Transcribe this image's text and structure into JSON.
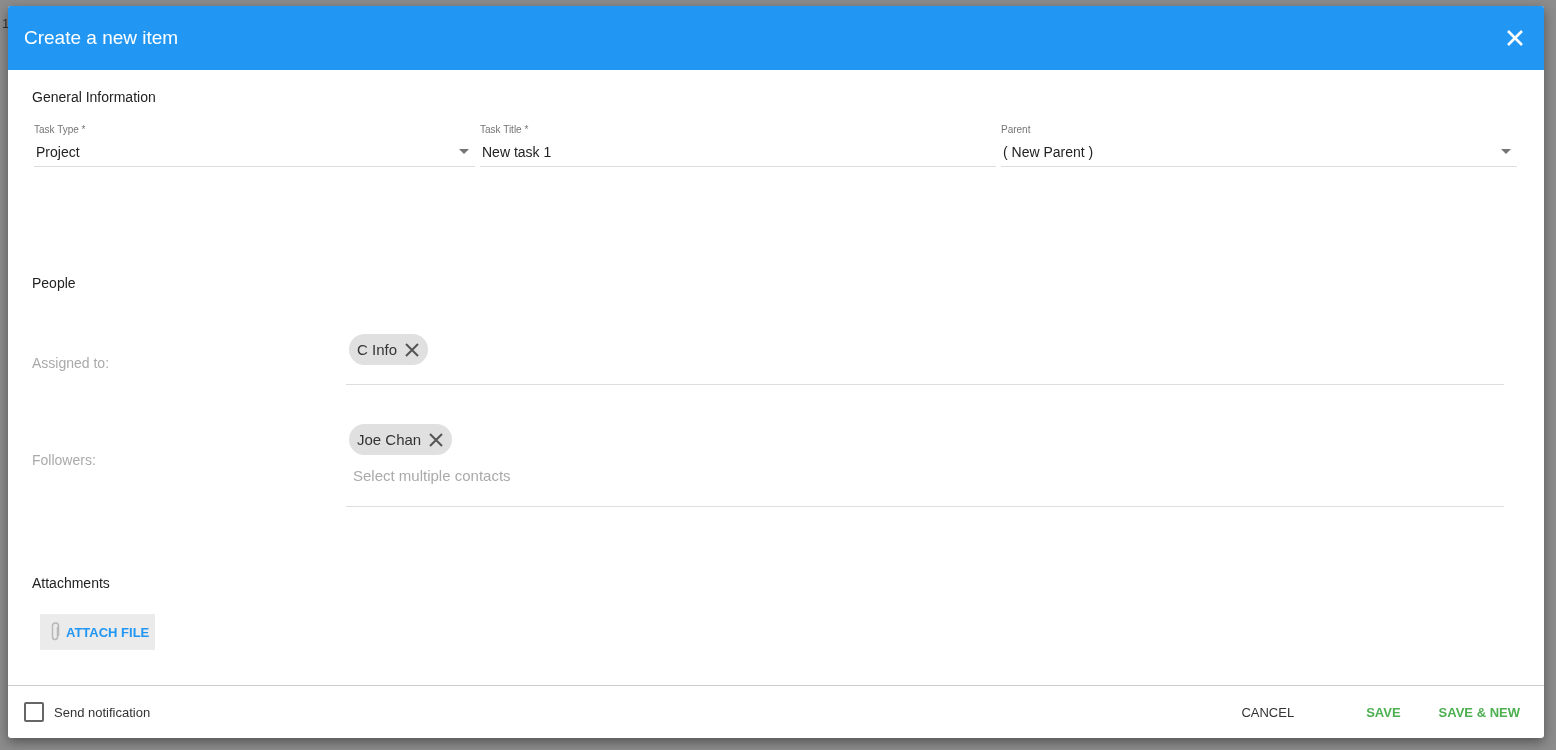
{
  "background": {
    "cell_text": "1"
  },
  "dialog": {
    "title": "Create a new item"
  },
  "general": {
    "heading": "General Information",
    "fields": [
      {
        "kind": "select",
        "label": "Task Type *",
        "value": "Project"
      },
      {
        "kind": "text",
        "label": "Task Title *",
        "value": "New task 1"
      },
      {
        "kind": "select",
        "label": "Parent",
        "value": "( New Parent )"
      }
    ]
  },
  "people": {
    "heading": "People",
    "rows": [
      {
        "label": "Assigned to:",
        "chips": [
          "C Info"
        ]
      },
      {
        "label": "Followers:",
        "chips": [
          "Joe Chan"
        ],
        "placeholder": "Select multiple contacts"
      }
    ]
  },
  "attachments": {
    "heading": "Attachments",
    "button": "ATTACH FILE"
  },
  "footer": {
    "notification": {
      "label": "Send notification",
      "checked": false
    },
    "buttons": [
      {
        "label": "CANCEL",
        "kind": "neutral"
      },
      {
        "label": "SAVE",
        "kind": "primary"
      },
      {
        "label": "SAVE & NEW",
        "kind": "primary"
      }
    ]
  }
}
